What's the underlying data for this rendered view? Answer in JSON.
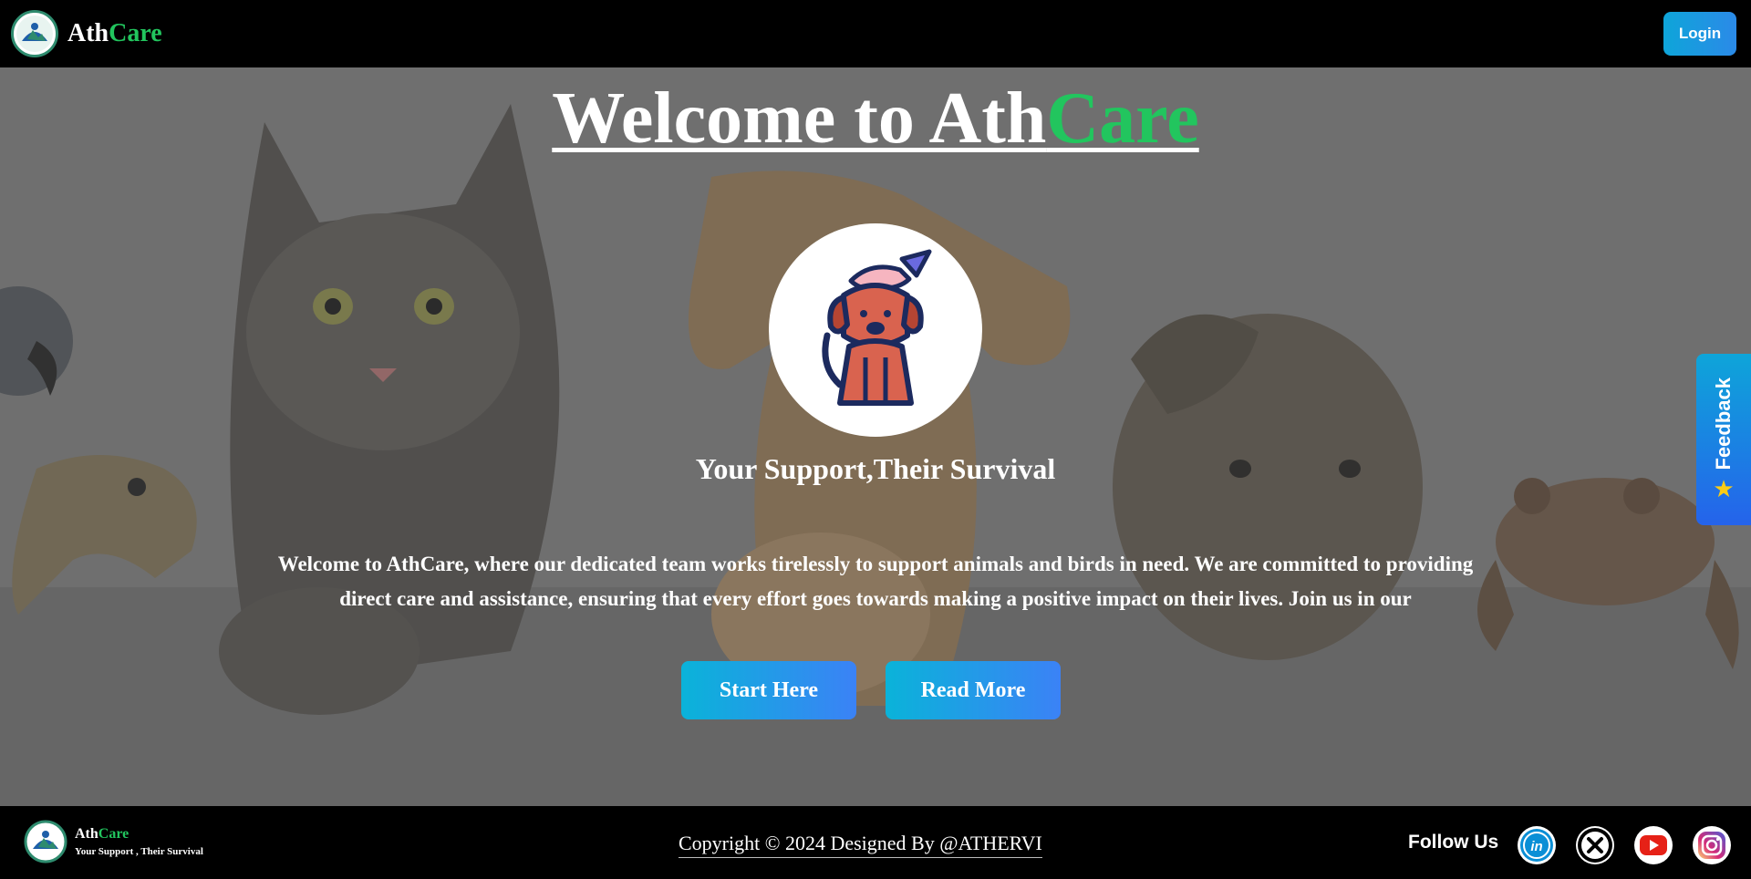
{
  "nav": {
    "brand_a": "Ath",
    "brand_b": "Care",
    "login_label": "Login"
  },
  "hero": {
    "title_a": "Welcome to Ath",
    "title_b": "Care",
    "tagline": "Your Support,Their Survival",
    "description": "Welcome to AthCare, where our dedicated team works tirelessly to support animals and birds in need. We are committed to providing direct care and assistance, ensuring that every effort goes towards making a positive impact on their lives. Join us in our",
    "start_label": "Start Here",
    "read_label": "Read More"
  },
  "feedback": {
    "label": "Feedback",
    "icon": "star-icon"
  },
  "footer": {
    "brand_a": "Ath",
    "brand_b": "Care",
    "brand_tagline": "Your Support , Their Survival",
    "copyright": "Copyright © 2024 Designed By @ATHERVI",
    "follow_label": "Follow Us",
    "socials": [
      "linkedin-icon",
      "x-icon",
      "youtube-icon",
      "instagram-icon"
    ]
  },
  "colors": {
    "accent_green": "#22c55e",
    "button_gradient_start": "#0ab3d9",
    "button_gradient_end": "#3b82f6"
  }
}
